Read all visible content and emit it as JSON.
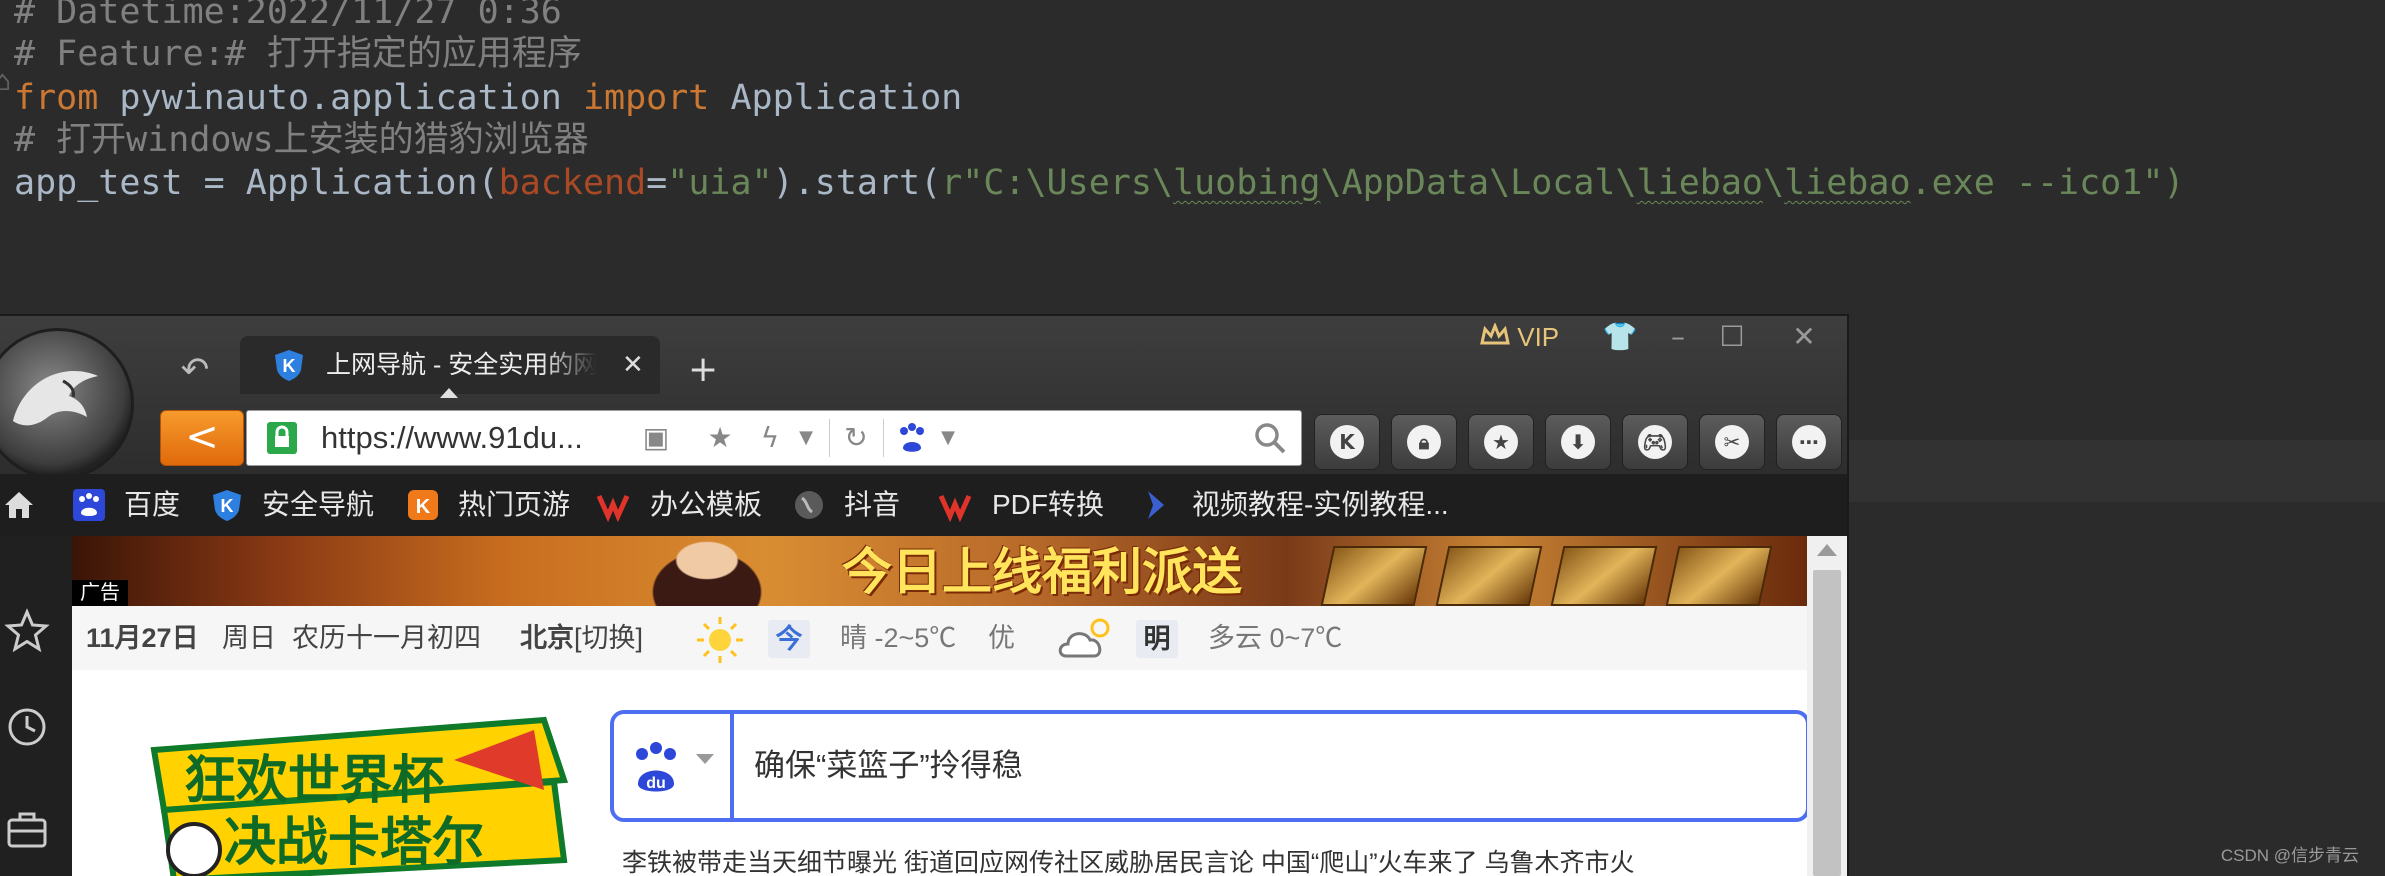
{
  "editor": {
    "lines": {
      "l1": "# Datetime:2022/11/27 0:36",
      "l2": "# Feature:# 打开指定的应用程序",
      "l3_kw_from": "from",
      "l3_module": " pywinauto.application ",
      "l3_kw_import": "import",
      "l3_name": " Application",
      "l4": "# 打开windows上安装的猎豹浏览器",
      "l5_a": "app_test = Application(",
      "l5_param": "backend",
      "l5_eq": "=",
      "l5_str": "\"uia\"",
      "l5_b": ").start(",
      "l5_r": "r\"C:\\Users\\",
      "l5_s1": "luobing",
      "l5_s2": "\\AppData\\Local\\",
      "l5_s3": "liebao",
      "l5_s4": "\\",
      "l5_s5": "liebao",
      "l5_s6": ".exe --ico1\")"
    },
    "gutter_mark": "⌂",
    "watermark": "CSDN @信步青云",
    "colors": {
      "background": "#2b2b2b",
      "keyword": "#cc7832",
      "comment": "#808080",
      "string": "#6a8759",
      "text": "#a9b7c6"
    }
  },
  "browser": {
    "tab": {
      "title": "上网导航 - 安全实用的网址导航",
      "close": "✕",
      "new_tab": "+"
    },
    "back_arrow": "↶",
    "vip_label": "VIP",
    "window_buttons": {
      "skin": "👕",
      "minimize": "–",
      "maximize": "☐",
      "close": "✕"
    },
    "address": {
      "url": "https://www.91du...",
      "nav_back": "<"
    },
    "toolbar_icons": [
      "k-icon",
      "lock-icon",
      "star-icon",
      "download-icon",
      "gamepad-icon",
      "scissors-icon",
      "more-icon"
    ],
    "bookmarks": [
      "百度",
      "安全导航",
      "热门页游",
      "办公模板",
      "抖音",
      "PDF转换",
      "视频教程-实例教程..."
    ],
    "page": {
      "ad_tag": "广告",
      "banner_text": "今日上线福利派送",
      "date": "11月27日",
      "weekday": "周日",
      "lunar": "农历十一月初四",
      "city": "北京",
      "switch": "[切换]",
      "today_label": "今",
      "today_weather": "晴 -2~5℃",
      "air_quality": "优",
      "tomorrow_label": "明",
      "tomorrow_weather": "多云 0~7℃",
      "logo_line1": "狂欢世界杯",
      "logo_line2": "决战卡塔尔",
      "search_text": "确保“菜篮子”拎得稳",
      "news_line": "李铁被带走当天细节曝光 街道回应网传社区威胁居民言论 中国“爬山”火车来了 乌鲁木齐市火"
    }
  }
}
